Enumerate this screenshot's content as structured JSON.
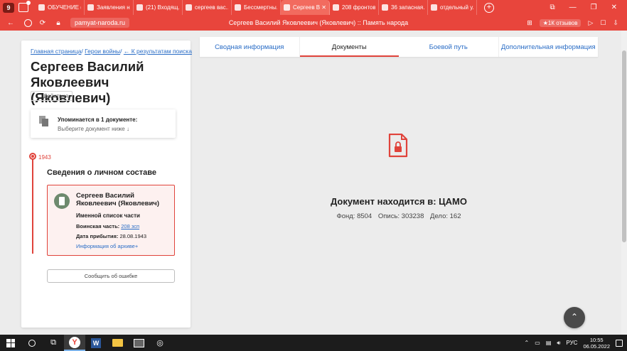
{
  "browser": {
    "tab_count": "9",
    "tabs": [
      {
        "label": "ОБУЧЕНИЕ (1...",
        "active": false
      },
      {
        "label": "Заявления на...",
        "active": false
      },
      {
        "label": "(21) Входящ...",
        "active": false
      },
      {
        "label": "сергеев вас...",
        "active": false
      },
      {
        "label": "Бессмертны...",
        "active": false
      },
      {
        "label": "Сергеев В...",
        "active": true
      },
      {
        "label": "208 фронтов...",
        "active": false
      },
      {
        "label": "36 запасная...",
        "active": false
      },
      {
        "label": "отдельный у...",
        "active": false
      }
    ],
    "new_tab": "+",
    "url": "pamyat-naroda.ru",
    "page_title": "Сергеев Василий Яковлеевич (Яковлевич) :: Память народа",
    "reviews": "★1К отзывов"
  },
  "left": {
    "breadcrumb": {
      "home": "Главная страница",
      "heroes": "Герои войны",
      "back": "← К результатам поиска"
    },
    "person_name": "Сергеев Василий Яковлеевич (Яковлевич)",
    "actions_label": "Действия",
    "mention": {
      "title": "Упоминается в 1 документе:",
      "subtitle": "Выберите документ ниже ↓"
    },
    "timeline": {
      "year": "1943",
      "section_title": "Сведения о личном составе"
    },
    "record": {
      "name": "Сергеев Василий Яковлеевич (Яковлевич)",
      "type": "Именной список части",
      "unit_label": "Воинская часть:",
      "unit_value": "208 зсп",
      "date_label": "Дата прибытия:",
      "date_value": "28.08.1943",
      "archive_link": "Информация об архиве+"
    },
    "report_button": "Сообщить об ошибке"
  },
  "main": {
    "tabs": [
      {
        "label": "Сводная информация",
        "active": false
      },
      {
        "label": "Документы",
        "active": true
      },
      {
        "label": "Боевой путь",
        "active": false
      },
      {
        "label": "Дополнительная информация",
        "active": false
      }
    ],
    "location_text": "Документ находится в: ЦАМО",
    "fund": "Фонд: 8504",
    "opis": "Опись: 303238",
    "delo": "Дело: 162"
  },
  "taskbar": {
    "lang": "РУС",
    "time": "10:55",
    "date": "06.05.2022"
  },
  "colors": {
    "brand_red": "#e8453c",
    "link_blue": "#2a6dc6"
  }
}
